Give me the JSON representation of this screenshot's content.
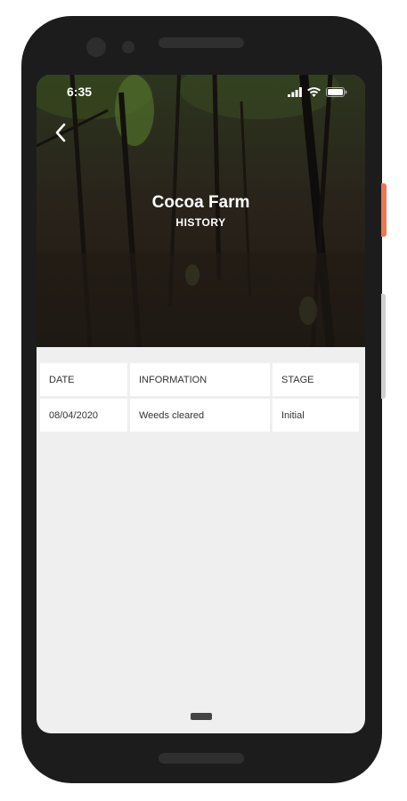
{
  "status_bar": {
    "time": "6:35",
    "signal_icon": "signal-icon",
    "wifi_icon": "wifi-icon",
    "battery_icon": "battery-icon"
  },
  "header": {
    "back_icon": "chevron-left-icon",
    "title": "Cocoa Farm",
    "subtitle": "HISTORY"
  },
  "history_table": {
    "columns": [
      "DATE",
      "INFORMATION",
      "STAGE"
    ],
    "rows": [
      [
        "08/04/2020",
        "Weeds cleared",
        "Initial"
      ]
    ]
  },
  "colors": {
    "device_frame": "#1c1c1c",
    "screen_background": "#efefef",
    "cell_background": "#ffffff",
    "side_button_accent": "#e9784f"
  }
}
